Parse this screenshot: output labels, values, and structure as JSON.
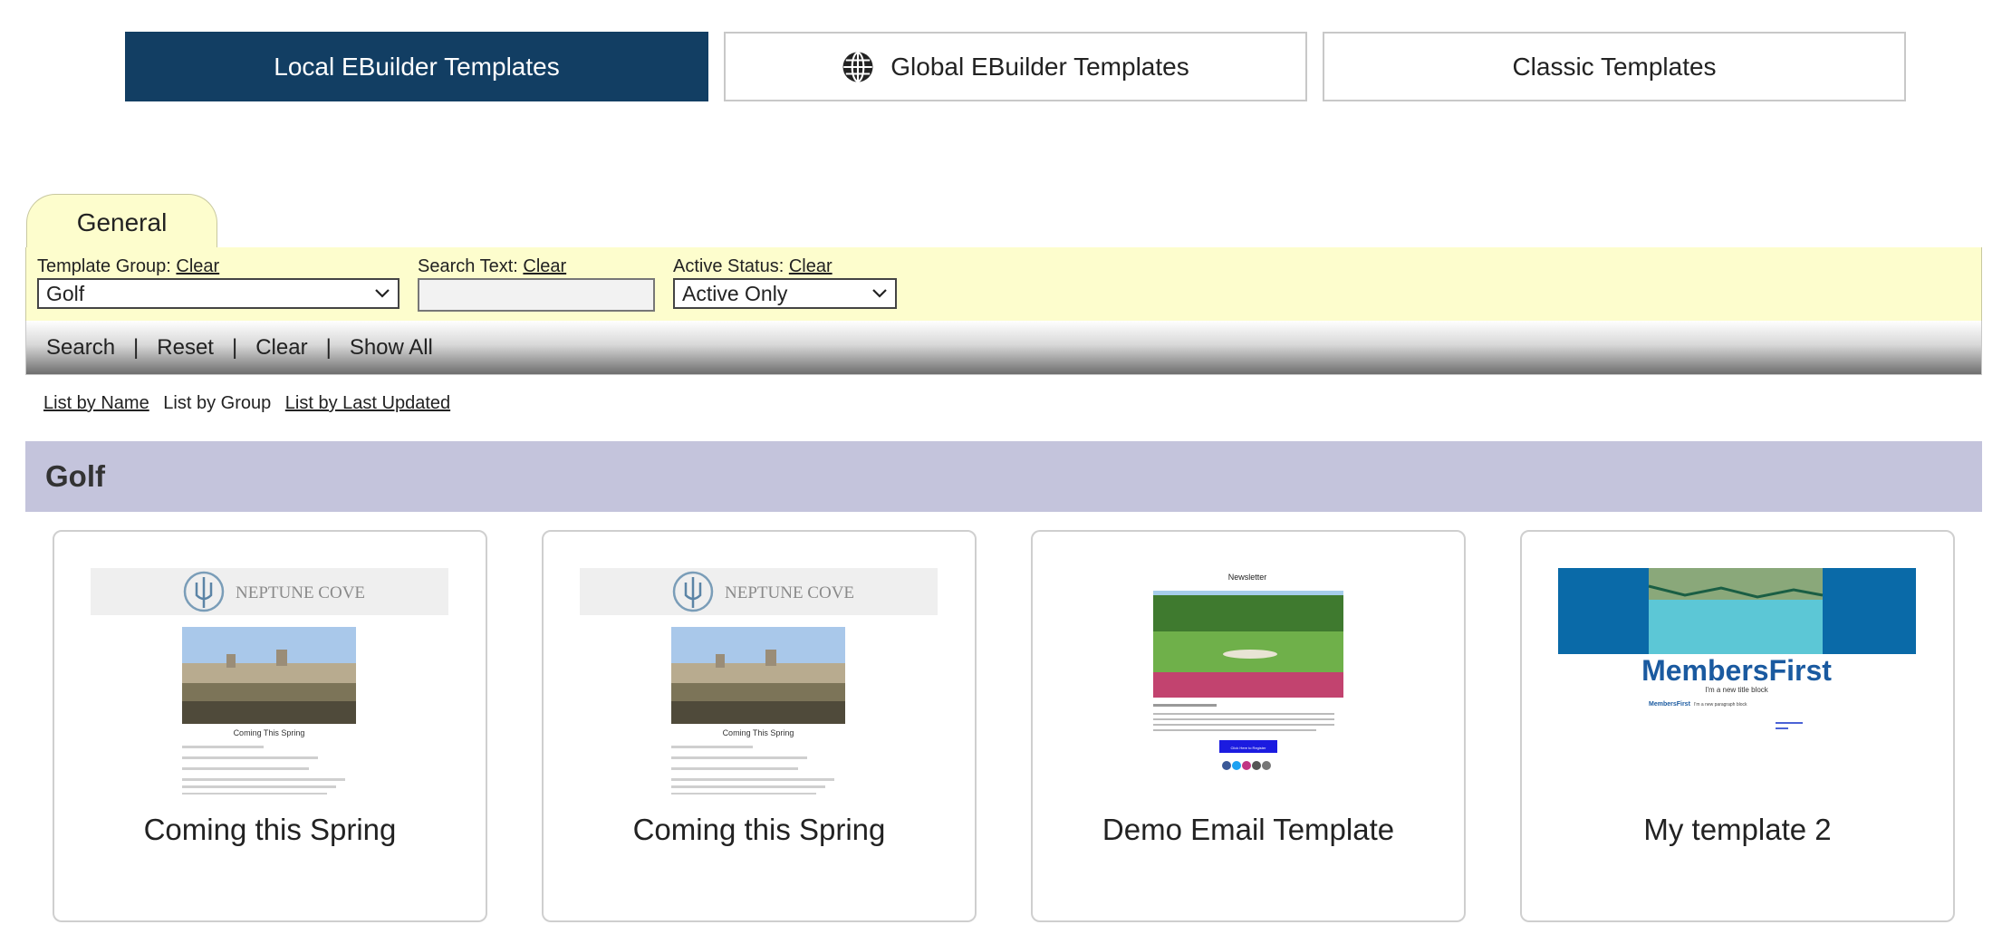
{
  "top_tabs": [
    {
      "label": "Local EBuilder Templates",
      "active": true
    },
    {
      "label": "Global EBuilder Templates",
      "icon": "globe-icon"
    },
    {
      "label": "Classic Templates"
    }
  ],
  "filter": {
    "tab_label": "General",
    "template_group": {
      "label": "Template Group:",
      "clear": "Clear",
      "value": "Golf"
    },
    "search_text": {
      "label": "Search Text:",
      "clear": "Clear",
      "value": ""
    },
    "active_status": {
      "label": "Active Status:",
      "clear": "Clear",
      "value": "Active Only"
    }
  },
  "actions": {
    "search": "Search",
    "reset": "Reset",
    "clear": "Clear",
    "show_all": "Show All",
    "separator": "|"
  },
  "list_options": {
    "by_name": "List by Name",
    "by_group": "List by Group",
    "by_last_updated": "List by Last Updated"
  },
  "group": {
    "title": "Golf"
  },
  "cards": [
    {
      "name": "Coming this Spring",
      "thumb": {
        "logo_text": "NEPTUNE COVE",
        "caption": "Coming This Spring"
      }
    },
    {
      "name": "Coming this Spring",
      "thumb": {
        "logo_text": "NEPTUNE COVE",
        "caption": "Coming This Spring"
      }
    },
    {
      "name": "Demo Email Template",
      "thumb": {
        "heading": "Newsletter",
        "button_text": "Click Here to Register"
      }
    },
    {
      "name": "My template 2",
      "thumb": {
        "brand": "MembersFirst",
        "tagline": "I'm a new title block",
        "small_brand": "MembersFirst",
        "small_text": "I'm a new paragraph block"
      }
    }
  ],
  "colors": {
    "active_tab": "#123e63",
    "filter_bg": "#fdfdcd",
    "group_header_bg": "#c4c4dc",
    "brand_blue": "#0a6aa8"
  }
}
